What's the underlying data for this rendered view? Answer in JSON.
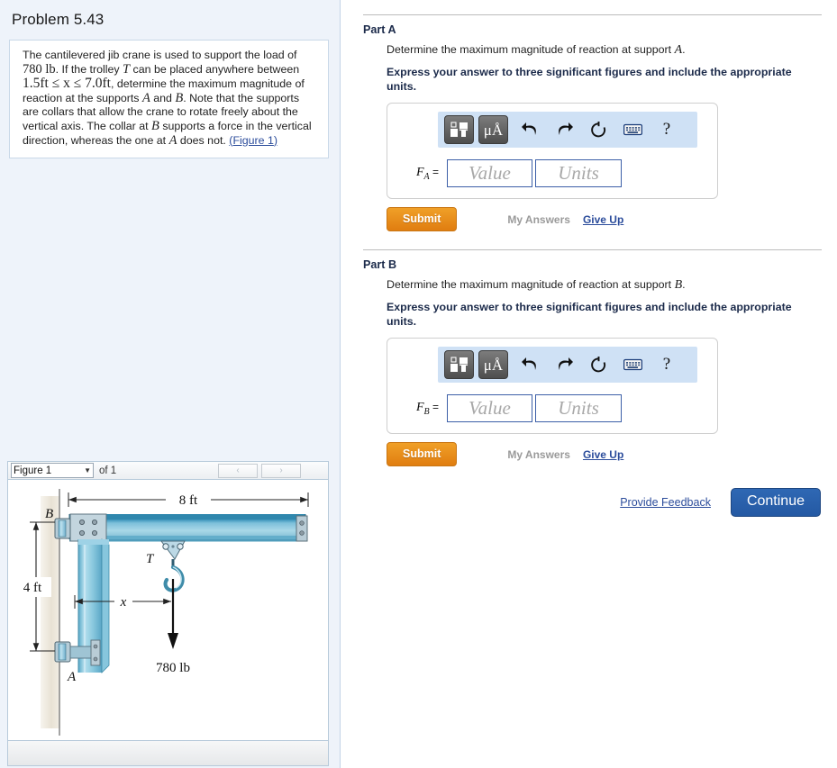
{
  "problem": {
    "title": "Problem 5.43",
    "statement_parts": [
      {
        "t": "The cantilevered jib crane is used to support the load of ",
        "k": "n"
      },
      {
        "t": "780 lb",
        "k": "up"
      },
      {
        "t": ". If the trolley ",
        "k": "n"
      },
      {
        "t": "T",
        "k": "it"
      },
      {
        "t": " can be placed anywhere between ",
        "k": "n"
      },
      {
        "t": "1.5ft ≤ x ≤ 7.0ft",
        "k": "big"
      },
      {
        "t": ", determine the maximum magnitude of reaction at the supports ",
        "k": "n"
      },
      {
        "t": "A",
        "k": "it"
      },
      {
        "t": " and ",
        "k": "n"
      },
      {
        "t": "B",
        "k": "it"
      },
      {
        "t": ". Note that the supports are collars that allow the crane to rotate freely about the vertical axis. The collar at ",
        "k": "n"
      },
      {
        "t": "B",
        "k": "it"
      },
      {
        "t": " supports a force in the vertical direction, whereas the one at ",
        "k": "n"
      },
      {
        "t": "A",
        "k": "it"
      },
      {
        "t": " does not. ",
        "k": "n"
      }
    ],
    "figure_link": "Figure 1",
    "figure_link_open": "(",
    "figure_link_close": ")"
  },
  "figure_panel": {
    "selected_figure": "Figure 1",
    "caret": "▼",
    "of_label": "of 1",
    "prev_label": "‹",
    "next_label": "›"
  },
  "figure": {
    "label_B": "B",
    "label_A": "A",
    "label_T": "T",
    "label_x": "x",
    "dim_horizontal": "8 ft",
    "dim_vertical": "4 ft",
    "load_label": "780 lb",
    "beam_color": "#8ec6dd",
    "beam_color_dark": "#3f9cc0",
    "beam_color_light": "#cbe7f2",
    "wall_color": "#ece7db"
  },
  "parts": [
    {
      "id": "A",
      "heading": "Part A",
      "question_pre": "Determine the maximum magnitude of reaction at support ",
      "question_var": "A",
      "question_post": ".",
      "instruction": "Express your answer to three significant figures and include the appropriate units.",
      "var_name": "F",
      "var_sub": "A",
      "equals": "=",
      "value_placeholder": "Value",
      "units_placeholder": "Units",
      "value_current": "",
      "units_current": "",
      "submit_label": "Submit",
      "my_answers_label": "My Answers",
      "give_up_label": "Give Up"
    },
    {
      "id": "B",
      "heading": "Part B",
      "question_pre": "Determine the maximum magnitude of reaction at support ",
      "question_var": "B",
      "question_post": ".",
      "instruction": "Express your answer to three significant figures and include the appropriate units.",
      "var_name": "F",
      "var_sub": "B",
      "equals": "=",
      "value_placeholder": "Value",
      "units_placeholder": "Units",
      "value_current": "",
      "units_current": "",
      "submit_label": "Submit",
      "my_answers_label": "My Answers",
      "give_up_label": "Give Up"
    }
  ],
  "math_toolbar": {
    "template_icon": "math-template-icon",
    "units_icon_label": "μÅ",
    "undo_icon": "undo-icon",
    "redo_icon": "redo-icon",
    "reset_icon": "reset-icon",
    "keyboard_icon": "keyboard-icon",
    "help_label": "?"
  },
  "footer": {
    "feedback_label": "Provide Feedback",
    "continue_label": "Continue"
  },
  "colors": {
    "accent_orange": "#e58a18",
    "accent_blue": "#2459a3",
    "link_blue": "#2b4c9b",
    "panel_bg": "#eef3fa",
    "toolbar_bg": "#cfe1f5"
  }
}
